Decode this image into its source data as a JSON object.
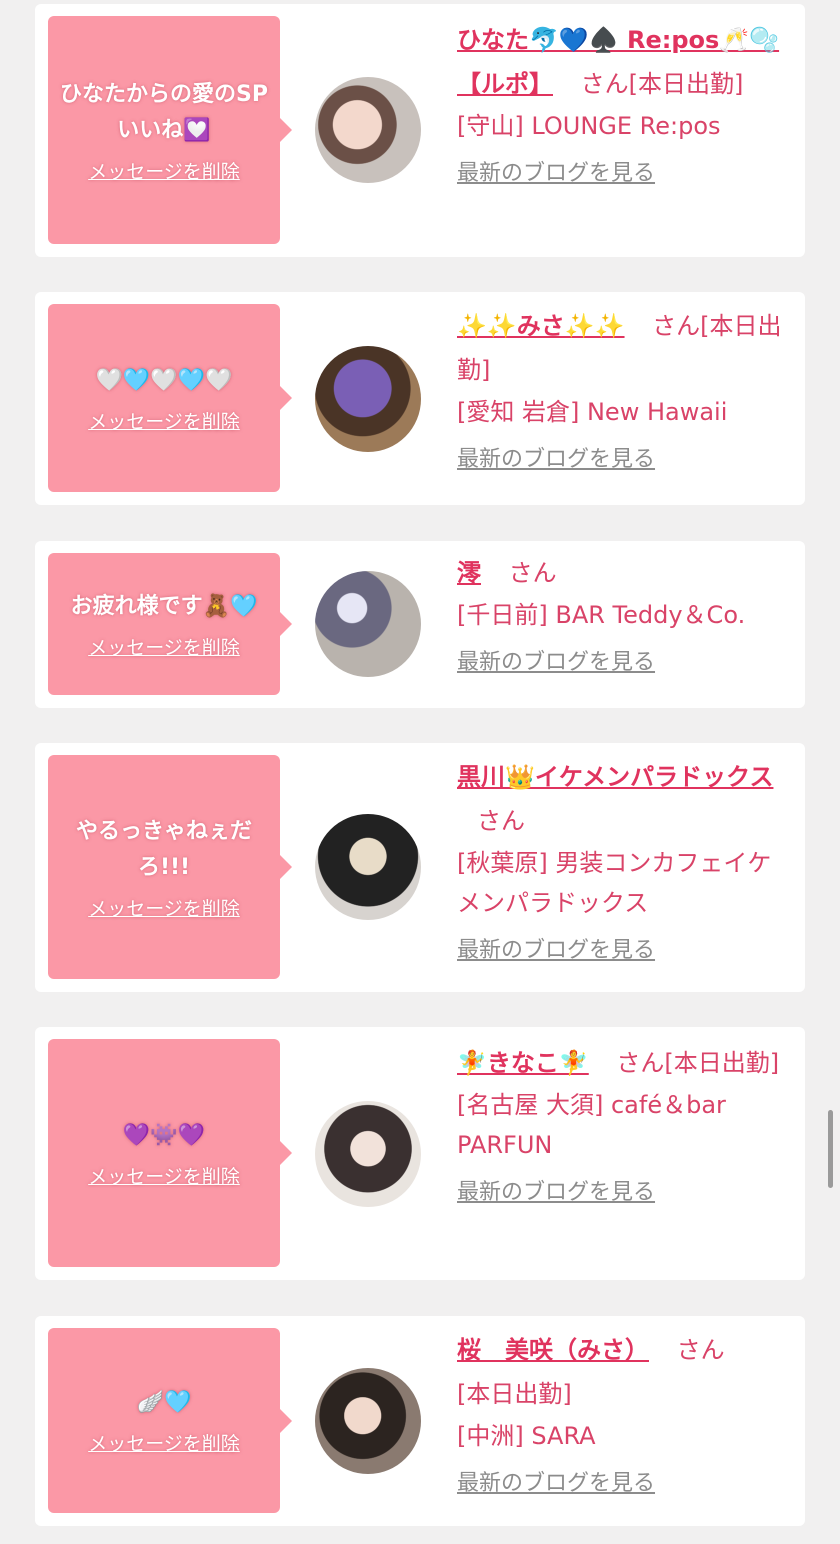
{
  "common": {
    "delete_label": "メッセージを削除",
    "blog_label": "最新のブログを見る"
  },
  "cards": [
    {
      "message": "ひなたからの愛のSPいいね💟",
      "name": "ひなた🐬💙♠️ Re:pos🥂🫧【ルポ】",
      "san": "さん",
      "status": "[本日出勤]",
      "shop": "[守山] LOUNGE Re:pos"
    },
    {
      "message": "🤍🩵🤍🩵🤍",
      "name": "✨✨みさ✨✨",
      "san": "さん",
      "status": "[本日出勤]",
      "shop": "[愛知 岩倉] New Hawaii"
    },
    {
      "message": "お疲れ様です🧸🩵",
      "name": "澪",
      "san": "さん",
      "status": "",
      "shop": "[千日前] BAR Teddy＆Co."
    },
    {
      "message": "やるっきゃねぇだろ!!!",
      "name": "黒川👑イケメンパラドックス",
      "san": "さん",
      "status": "",
      "shop": "[秋葉原] 男装コンカフェイケメンパラドックス"
    },
    {
      "message": "💜👾💜",
      "name": "🧚きなこ🧚",
      "san": "さん",
      "status": "[本日出勤]",
      "shop": "[名古屋 大須] café＆bar PARFUN"
    },
    {
      "message": "🪽🩵",
      "name": "桜　美咲（みさ）",
      "san": "さん",
      "status": "[本日出勤]",
      "shop": "[中洲] SARA"
    }
  ]
}
